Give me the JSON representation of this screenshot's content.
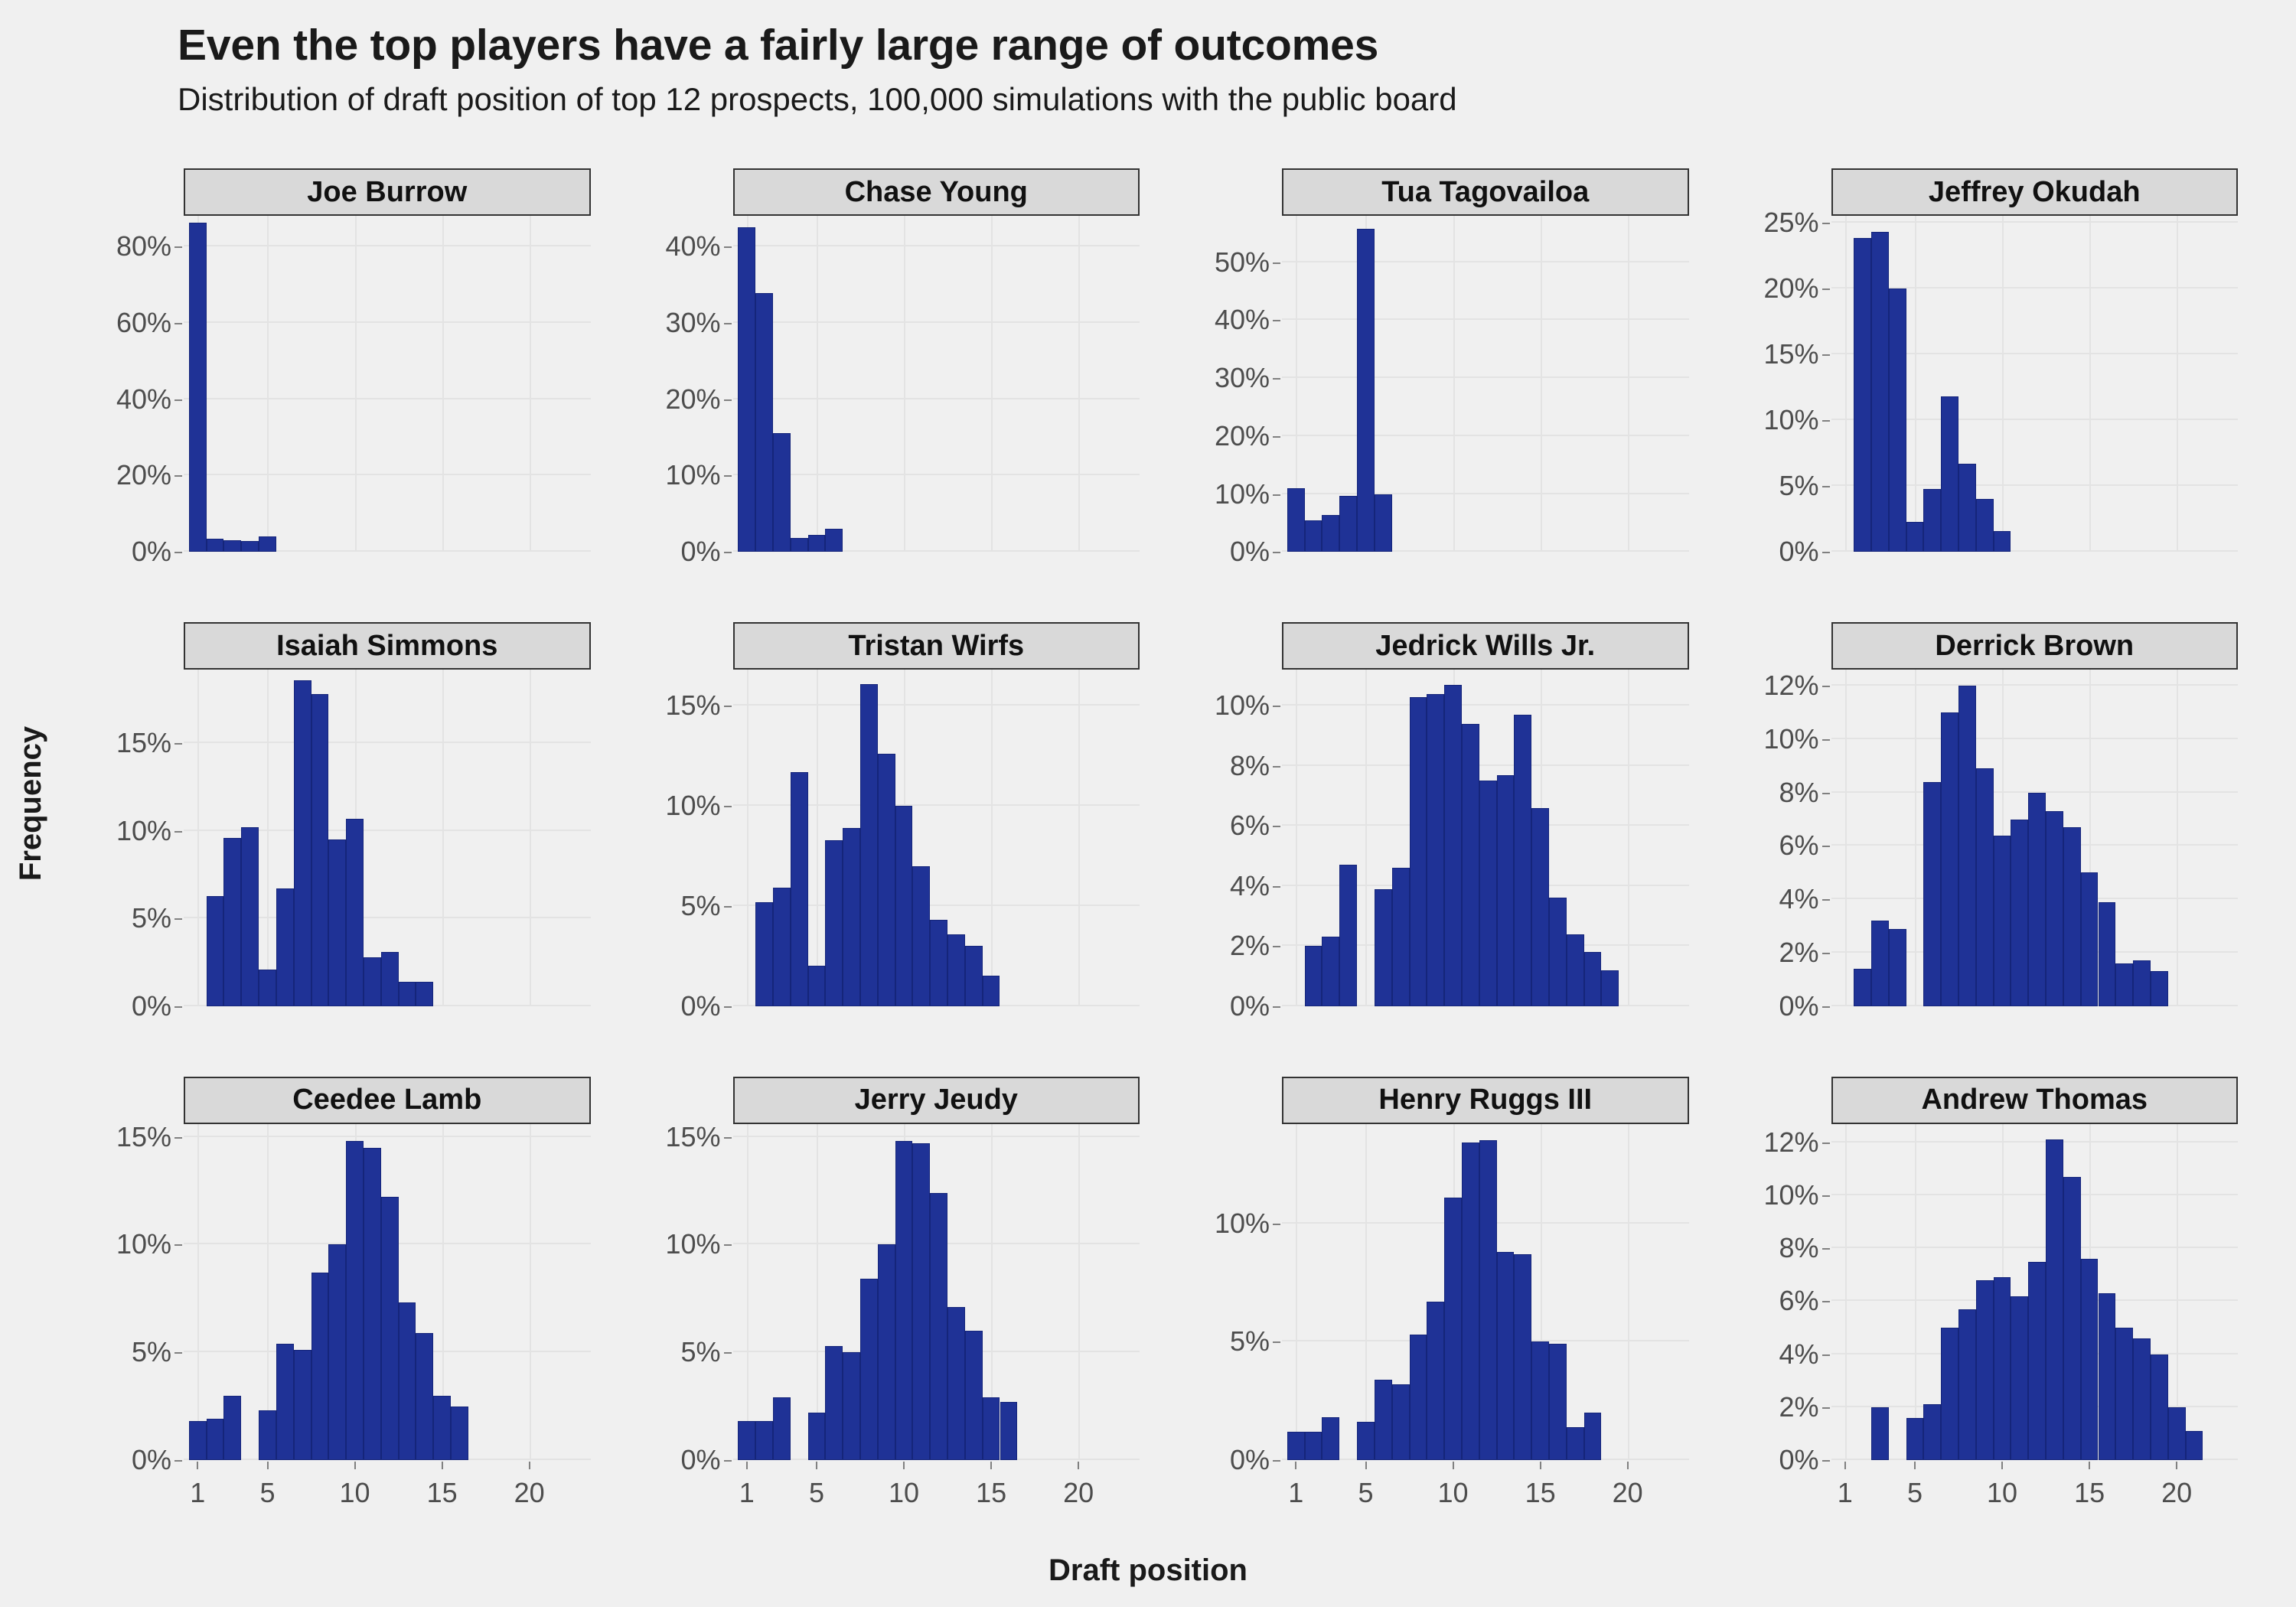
{
  "title": "Even the top players have a fairly large range of outcomes",
  "subtitle": "Distribution of draft position of top 12 prospects, 100,000 simulations with the public board",
  "axis": {
    "ylabel": "Frequency",
    "xlabel": "Draft position"
  },
  "style": {
    "bar_color": "#1f3296",
    "bar_border": "#15257a",
    "panel_bg": "#f0f0f0",
    "strip_bg": "#d9d9d9",
    "grid_color": "#e3e3e3",
    "tick_text": "#4d4d4d"
  },
  "chart_data": {
    "type": "bar",
    "title": "Even the top players have a fairly large range of outcomes",
    "subtitle": "Distribution of draft position of top 12 prospects, 100,000 simulations with the public board",
    "xlabel": "Draft position",
    "ylabel": "Frequency",
    "grid": true,
    "legend": "none",
    "facet": "player",
    "shared_x": true,
    "shared_y": false,
    "x_ticks": [
      1,
      5,
      10,
      15,
      20
    ],
    "x_tick_labels": [
      "1",
      "5",
      "10",
      "15",
      "20"
    ],
    "xlim": [
      0.2,
      23.5
    ],
    "value_unit": "percent",
    "panels": [
      {
        "name": "Joe Burrow",
        "ylim": [
          0,
          88
        ],
        "y_ticks": [
          0,
          20,
          40,
          60,
          80
        ],
        "y_tick_labels": [
          "0%",
          "20%",
          "40%",
          "60%",
          "80%"
        ],
        "x": [
          1,
          2,
          3,
          4,
          5
        ],
        "values": [
          86.2,
          3.4,
          3.0,
          2.9,
          4.1
        ]
      },
      {
        "name": "Chase Young",
        "ylim": [
          0,
          44
        ],
        "y_ticks": [
          0,
          10,
          20,
          30,
          40
        ],
        "y_tick_labels": [
          "0%",
          "10%",
          "20%",
          "30%",
          "40%"
        ],
        "x": [
          1,
          2,
          3,
          4,
          5,
          6
        ],
        "values": [
          42.5,
          33.9,
          15.6,
          1.8,
          2.2,
          3.0
        ]
      },
      {
        "name": "Tua Tagovailoa",
        "ylim": [
          0,
          58
        ],
        "y_ticks": [
          0,
          10,
          20,
          30,
          40,
          50
        ],
        "y_tick_labels": [
          "0%",
          "10%",
          "20%",
          "30%",
          "40%",
          "50%"
        ],
        "x": [
          1,
          2,
          3,
          4,
          5,
          6
        ],
        "values": [
          11.0,
          5.5,
          6.4,
          9.7,
          55.8,
          9.9
        ]
      },
      {
        "name": "Jeffrey Okudah",
        "ylim": [
          0,
          25.5
        ],
        "y_ticks": [
          0,
          5,
          10,
          15,
          20,
          25
        ],
        "y_tick_labels": [
          "0%",
          "5%",
          "10%",
          "15%",
          "20%",
          "25%"
        ],
        "x": [
          2,
          3,
          4,
          5,
          6,
          7,
          8,
          9,
          10
        ],
        "values": [
          23.8,
          24.3,
          20.0,
          2.3,
          4.8,
          11.8,
          6.7,
          4.0,
          1.6
        ]
      },
      {
        "name": "Isaiah Simmons",
        "ylim": [
          0,
          19.2
        ],
        "y_ticks": [
          0,
          5,
          10,
          15
        ],
        "y_tick_labels": [
          "0%",
          "5%",
          "10%",
          "15%"
        ],
        "x": [
          2,
          3,
          4,
          5,
          6,
          7,
          8,
          9,
          10,
          11,
          12,
          13,
          14
        ],
        "values": [
          6.3,
          9.6,
          10.2,
          2.1,
          6.7,
          18.6,
          17.8,
          9.5,
          10.7,
          2.8,
          3.1,
          1.4,
          1.4
        ]
      },
      {
        "name": "Tristan Wirfs",
        "ylim": [
          0,
          16.8
        ],
        "y_ticks": [
          0,
          5,
          10,
          15
        ],
        "y_tick_labels": [
          "0%",
          "5%",
          "10%",
          "15%"
        ],
        "x": [
          2,
          3,
          4,
          5,
          6,
          7,
          8,
          9,
          10,
          11,
          12,
          13,
          14,
          15
        ],
        "values": [
          5.2,
          5.9,
          11.7,
          2.0,
          8.3,
          8.9,
          16.1,
          12.6,
          10.0,
          7.0,
          4.3,
          3.6,
          3.0,
          1.5
        ]
      },
      {
        "name": "Jedrick Wills Jr.",
        "ylim": [
          0,
          11.2
        ],
        "y_ticks": [
          0,
          2,
          4,
          6,
          8,
          10
        ],
        "y_tick_labels": [
          "0%",
          "2%",
          "4%",
          "6%",
          "8%",
          "10%"
        ],
        "x": [
          2,
          3,
          4,
          6,
          7,
          8,
          9,
          10,
          11,
          12,
          13,
          14,
          15,
          16,
          17,
          18,
          19
        ],
        "values": [
          2.0,
          2.3,
          4.7,
          3.9,
          4.6,
          10.3,
          10.4,
          10.7,
          9.4,
          7.5,
          7.7,
          9.7,
          6.6,
          3.6,
          2.4,
          1.8,
          1.2
        ]
      },
      {
        "name": "Derrick Brown",
        "ylim": [
          0,
          12.6
        ],
        "y_ticks": [
          0,
          2,
          4,
          6,
          8,
          10,
          12
        ],
        "y_tick_labels": [
          "0%",
          "2%",
          "4%",
          "6%",
          "8%",
          "10%",
          "12%"
        ],
        "x": [
          2,
          3,
          4,
          6,
          7,
          8,
          9,
          10,
          11,
          12,
          13,
          14,
          15,
          16,
          17,
          18,
          19,
          20
        ],
        "values": [
          1.4,
          3.2,
          2.9,
          8.4,
          11.0,
          12.0,
          8.9,
          6.4,
          7.0,
          8.0,
          7.3,
          6.7,
          5.0,
          3.9,
          1.6,
          1.7,
          1.3,
          0
        ]
      },
      {
        "name": "Ceedee Lamb",
        "ylim": [
          0,
          15.6
        ],
        "y_ticks": [
          0,
          5,
          10,
          15
        ],
        "y_tick_labels": [
          "0%",
          "5%",
          "10%",
          "15%"
        ],
        "x": [
          1,
          2,
          3,
          5,
          6,
          7,
          8,
          9,
          10,
          11,
          12,
          13,
          14,
          15,
          16,
          17
        ],
        "values": [
          1.8,
          1.9,
          3.0,
          2.3,
          5.4,
          5.1,
          8.7,
          10.0,
          14.8,
          14.5,
          12.2,
          7.3,
          5.9,
          3.0,
          2.5,
          0
        ]
      },
      {
        "name": "Jerry Jeudy",
        "ylim": [
          0,
          15.6
        ],
        "y_ticks": [
          0,
          5,
          10,
          15
        ],
        "y_tick_labels": [
          "0%",
          "5%",
          "10%",
          "15%"
        ],
        "x": [
          1,
          2,
          3,
          5,
          6,
          7,
          8,
          9,
          10,
          11,
          12,
          13,
          14,
          15,
          16,
          17
        ],
        "values": [
          1.8,
          1.8,
          2.9,
          2.2,
          5.3,
          5.0,
          8.4,
          10.0,
          14.8,
          14.7,
          12.4,
          7.1,
          6.0,
          2.9,
          2.7,
          0
        ]
      },
      {
        "name": "Henry Ruggs III",
        "ylim": [
          0,
          14.2
        ],
        "y_ticks": [
          0,
          5,
          10
        ],
        "y_tick_labels": [
          "0%",
          "5%",
          "10%"
        ],
        "x": [
          1,
          2,
          3,
          5,
          6,
          7,
          8,
          9,
          10,
          11,
          12,
          13,
          14,
          15,
          16,
          17,
          18
        ],
        "values": [
          1.2,
          1.2,
          1.8,
          1.6,
          3.4,
          3.2,
          5.3,
          6.7,
          11.1,
          13.4,
          13.5,
          8.8,
          8.7,
          5.0,
          4.9,
          1.4,
          2.0
        ]
      },
      {
        "name": "Andrew Thomas",
        "ylim": [
          0,
          12.7
        ],
        "y_ticks": [
          0,
          2,
          4,
          6,
          8,
          10,
          12
        ],
        "y_tick_labels": [
          "0%",
          "2%",
          "4%",
          "6%",
          "8%",
          "10%",
          "12%"
        ],
        "x": [
          3,
          5,
          6,
          7,
          8,
          9,
          10,
          11,
          12,
          13,
          14,
          15,
          16,
          17,
          18,
          19,
          20,
          21
        ],
        "values": [
          2.0,
          1.6,
          2.1,
          5.0,
          5.7,
          6.8,
          6.9,
          6.2,
          7.5,
          12.1,
          10.7,
          7.6,
          6.3,
          5.0,
          4.6,
          4.0,
          2.0,
          1.1
        ]
      }
    ]
  }
}
